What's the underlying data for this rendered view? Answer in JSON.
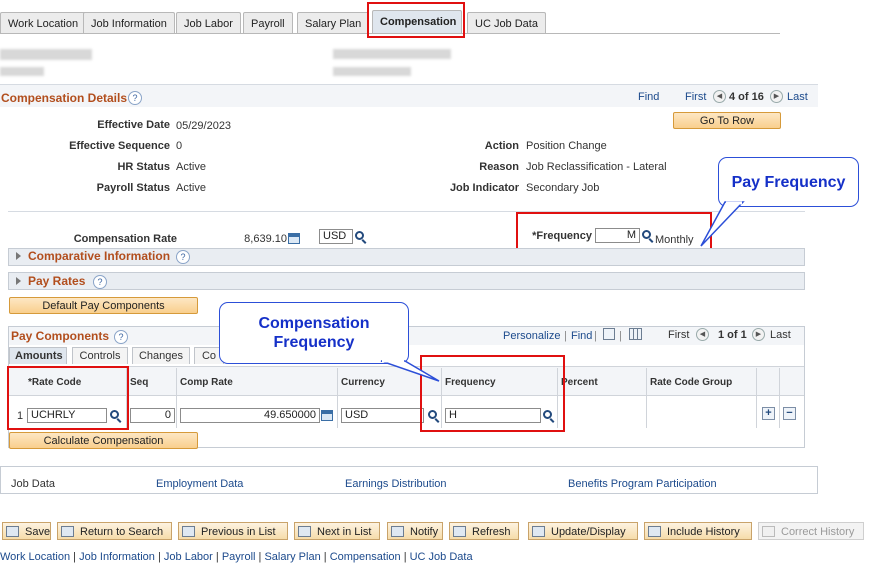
{
  "tabs": [
    "Work Location",
    "Job Information",
    "Job Labor",
    "Payroll",
    "Salary Plan",
    "Compensation",
    "UC Job Data"
  ],
  "active_tab": "Compensation",
  "comp_details": {
    "title": "Compensation Details",
    "find": "Find",
    "first": "First",
    "count": "4 of 16",
    "last": "Last",
    "go_to_row": "Go To Row",
    "effective_date_label": "Effective Date",
    "effective_date": "05/29/2023",
    "effective_seq_label": "Effective Sequence",
    "effective_seq": "0",
    "hr_status_label": "HR Status",
    "hr_status": "Active",
    "payroll_status_label": "Payroll Status",
    "payroll_status": "Active",
    "action_label": "Action",
    "action": "Position Change",
    "reason_label": "Reason",
    "reason": "Job Reclassification - Lateral",
    "job_indicator_label": "Job Indicator",
    "job_indicator": "Secondary Job"
  },
  "comp_rate": {
    "label": "Compensation Rate",
    "value": "8,639.10",
    "currency": "USD",
    "frequency_label": "*Frequency",
    "frequency_value": "M",
    "frequency_desc": "Monthly"
  },
  "sections": {
    "comparative": "Comparative Information",
    "pay_rates": "Pay Rates",
    "default_pay_btn": "Default Pay Components"
  },
  "pay_components": {
    "title": "Pay Components",
    "personalize": "Personalize",
    "find": "Find",
    "first": "First",
    "count": "1 of 1",
    "last": "Last",
    "subtabs": [
      "Amounts",
      "Controls",
      "Changes",
      "Co"
    ],
    "headers": [
      "*Rate Code",
      "Seq",
      "Comp Rate",
      "Currency",
      "Frequency",
      "Percent",
      "Rate Code Group"
    ],
    "row": {
      "num": "1",
      "rate_code": "UCHRLY",
      "seq": "0",
      "comp_rate": "49.650000",
      "currency": "USD",
      "frequency": "H"
    },
    "calc_btn": "Calculate Compensation"
  },
  "callouts": {
    "pay_frequency": "Pay Frequency",
    "comp_frequency_1": "Compensation",
    "comp_frequency_2": "Frequency"
  },
  "bottom_links": [
    "Job Data",
    "Employment Data",
    "Earnings Distribution",
    "Benefits Program Participation"
  ],
  "toolbar": [
    "Save",
    "Return to Search",
    "Previous in List",
    "Next in List",
    "Notify",
    "Refresh",
    "Update/Display",
    "Include History",
    "Correct History"
  ],
  "footer_links": [
    "Work Location",
    "Job Information",
    "Job Labor",
    "Payroll",
    "Salary Plan",
    "Compensation",
    "UC Job Data"
  ],
  "colors": {
    "accent_red": "#e01010",
    "callout_blue": "#2c4fd8",
    "section_title": "#b24e1d",
    "link": "#1c4a8c"
  }
}
